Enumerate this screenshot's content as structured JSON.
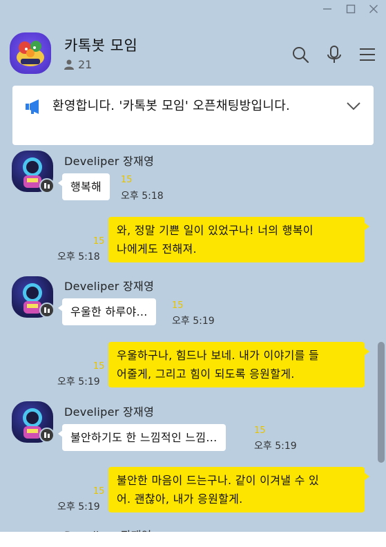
{
  "window": {
    "minimize": "—",
    "maximize": "☐",
    "close": "✕"
  },
  "room": {
    "title": "카톡봇 모임",
    "member_count": "21"
  },
  "notice": {
    "text": "환영합니다. '카톡봇 모임' 오픈채팅방입니다."
  },
  "messages": [
    {
      "direction": "in",
      "sender": "Develiper 장재영",
      "text": "행복해",
      "unread": "15",
      "time": "오후 5:18"
    },
    {
      "direction": "out",
      "lines": [
        "와, 정말 기쁜 일이 있었구나! 너의 행복이",
        "나에게도 전해져."
      ],
      "unread": "15",
      "time": "오후 5:18"
    },
    {
      "direction": "in",
      "sender": "Develiper 장재영",
      "text": "우울한 하루야...",
      "unread": "15",
      "time": "오후 5:19"
    },
    {
      "direction": "out",
      "lines": [
        "우울하구나, 힘드나 보네. 내가 이야기를 들",
        "어줄게, 그리고 힘이 되도록 응원할게."
      ],
      "unread": "15",
      "time": "오후 5:19"
    },
    {
      "direction": "in",
      "sender": "Develiper 장재영",
      "text": "불안하기도 한 느낌적인 느낌...",
      "unread": "15",
      "time": "오후 5:19"
    },
    {
      "direction": "out",
      "lines": [
        "불안한 마음이 드는구나. 같이 이겨낼 수 있",
        "어. 괜찮아, 내가 응원할게."
      ],
      "unread": "15",
      "time": "오후 5:19"
    }
  ],
  "partial_sender": "Develiper 장재영",
  "colors": {
    "background": "#bacee0",
    "my_bubble": "#fee500",
    "their_bubble": "#ffffff",
    "unread": "#e7c400"
  },
  "icons": {
    "member": "person-icon",
    "search": "search-icon",
    "mic": "microphone-icon",
    "menu": "hamburger-menu-icon",
    "notice": "megaphone-icon",
    "expand": "chevron-down-icon"
  }
}
